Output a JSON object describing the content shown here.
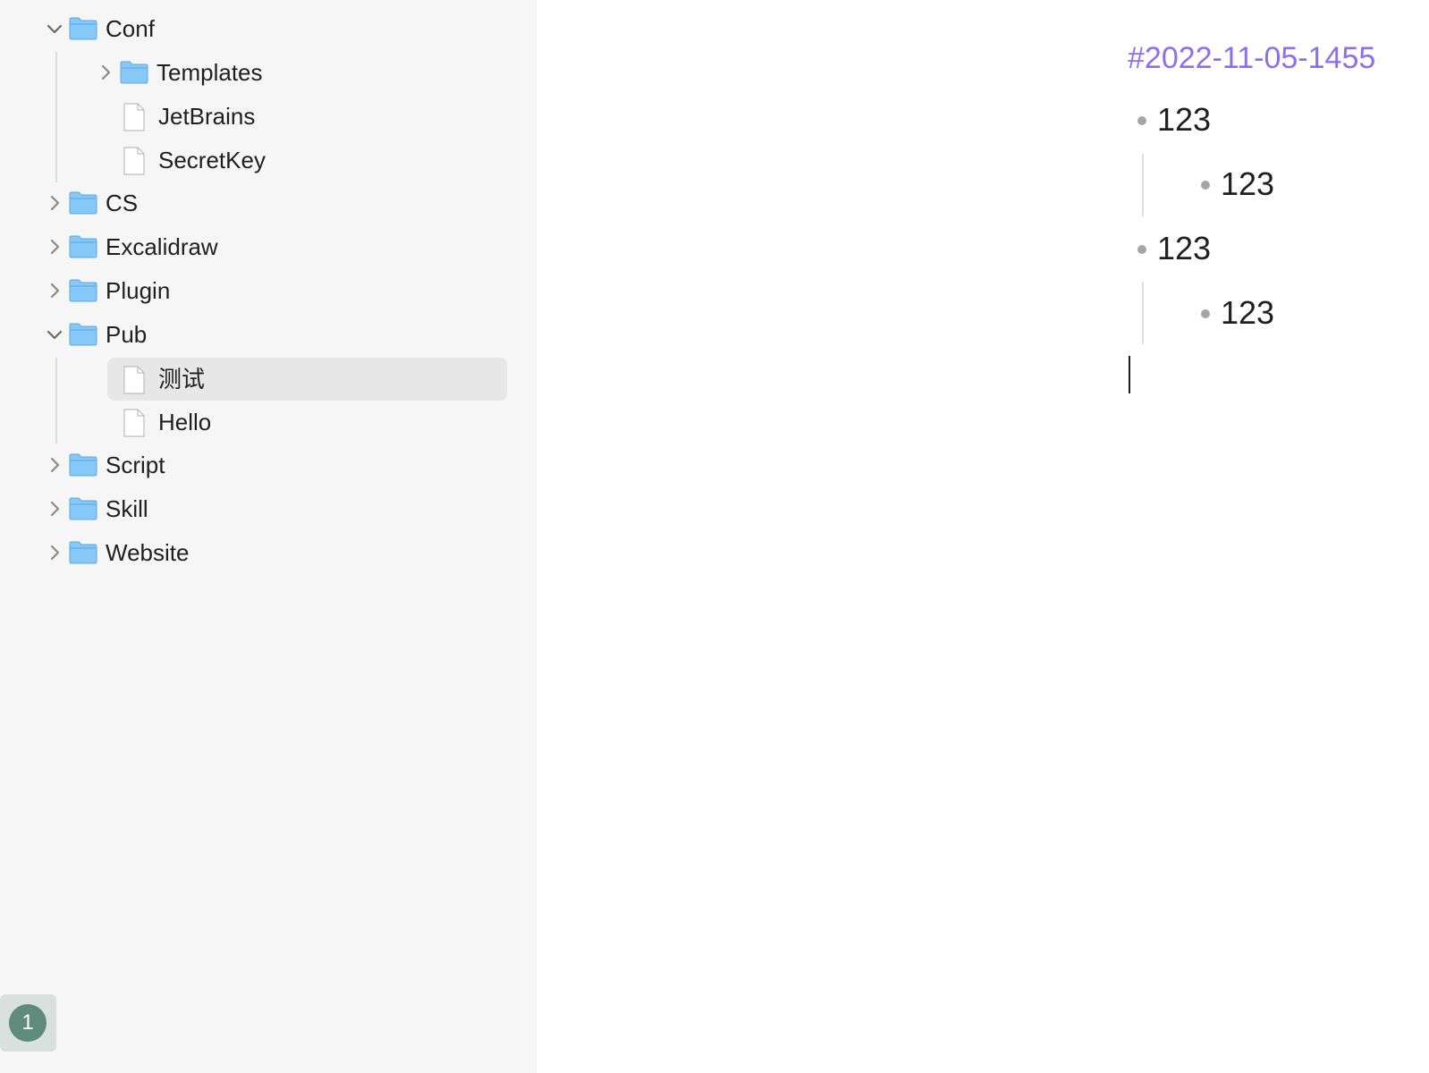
{
  "sidebar": {
    "tree": [
      {
        "label": "Conf",
        "type": "folder",
        "state": "expanded"
      },
      {
        "label": "Templates",
        "type": "folder",
        "state": "collapsed"
      },
      {
        "label": "JetBrains",
        "type": "file"
      },
      {
        "label": "SecretKey",
        "type": "file"
      },
      {
        "label": "CS",
        "type": "folder",
        "state": "collapsed"
      },
      {
        "label": "Excalidraw",
        "type": "folder",
        "state": "collapsed"
      },
      {
        "label": "Plugin",
        "type": "folder",
        "state": "collapsed"
      },
      {
        "label": "Pub",
        "type": "folder",
        "state": "expanded"
      },
      {
        "label": "测试",
        "type": "file",
        "selected": true
      },
      {
        "label": "Hello",
        "type": "file"
      },
      {
        "label": "Script",
        "type": "folder",
        "state": "collapsed"
      },
      {
        "label": "Skill",
        "type": "folder",
        "state": "collapsed"
      },
      {
        "label": "Website",
        "type": "folder",
        "state": "collapsed"
      }
    ],
    "badge": "1"
  },
  "editor": {
    "tag": "#2022-11-05-1455",
    "bullets": [
      {
        "text": "123",
        "level": 0
      },
      {
        "text": "123",
        "level": 1
      },
      {
        "text": "123",
        "level": 0
      },
      {
        "text": "123",
        "level": 1
      }
    ]
  },
  "colors": {
    "sidebar_bg": "#f6f6f6",
    "selected_bg": "#e7e7e7",
    "folder_blue": "#86c8f7",
    "tag_purple": "#8a6ff0",
    "badge_green": "#5f8b7c"
  },
  "icons": {
    "expanded": "chevron-down-icon",
    "collapsed": "chevron-right-icon",
    "folder": "folder-icon",
    "file": "file-icon"
  }
}
